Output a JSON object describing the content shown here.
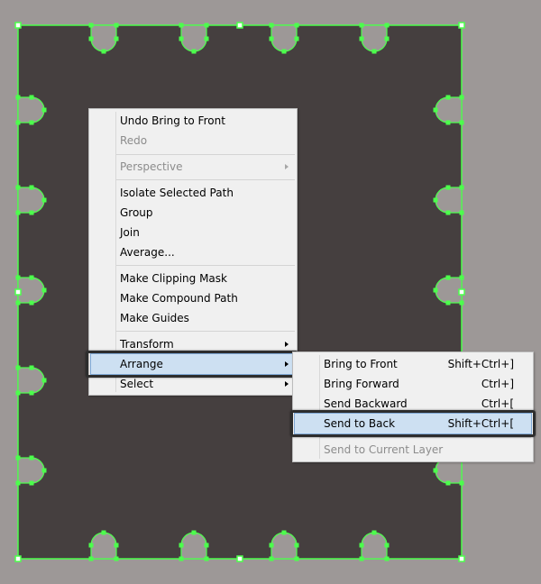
{
  "colors": {
    "background": "#9d9897",
    "shape_fill": "#453f3f",
    "selection": "#4cff4c",
    "menu_bg": "#f0f0f0",
    "highlight": "#cde0f2"
  },
  "context_menu": {
    "items": [
      {
        "label": "Undo Bring to Front",
        "enabled": true
      },
      {
        "label": "Redo",
        "enabled": false
      },
      {
        "separator": true
      },
      {
        "label": "Perspective",
        "enabled": false,
        "submenu": true
      },
      {
        "separator": true
      },
      {
        "label": "Isolate Selected Path",
        "enabled": true
      },
      {
        "label": "Group",
        "enabled": true
      },
      {
        "label": "Join",
        "enabled": true
      },
      {
        "label": "Average...",
        "enabled": true
      },
      {
        "separator": true
      },
      {
        "label": "Make Clipping Mask",
        "enabled": true
      },
      {
        "label": "Make Compound Path",
        "enabled": true
      },
      {
        "label": "Make Guides",
        "enabled": true
      },
      {
        "separator": true
      },
      {
        "label": "Transform",
        "enabled": true,
        "submenu": true
      },
      {
        "label": "Arrange",
        "enabled": true,
        "submenu": true,
        "highlighted": true
      },
      {
        "label": "Select",
        "enabled": true,
        "submenu": true
      }
    ]
  },
  "arrange_submenu": {
    "items": [
      {
        "label": "Bring to Front",
        "shortcut": "Shift+Ctrl+]",
        "enabled": true
      },
      {
        "label": "Bring Forward",
        "shortcut": "Ctrl+]",
        "enabled": true
      },
      {
        "label": "Send Backward",
        "shortcut": "Ctrl+[",
        "enabled": true
      },
      {
        "label": "Send to Back",
        "shortcut": "Shift+Ctrl+[",
        "enabled": true,
        "highlighted": true
      },
      {
        "separator": true
      },
      {
        "label": "Send to Current Layer",
        "enabled": false
      }
    ]
  }
}
